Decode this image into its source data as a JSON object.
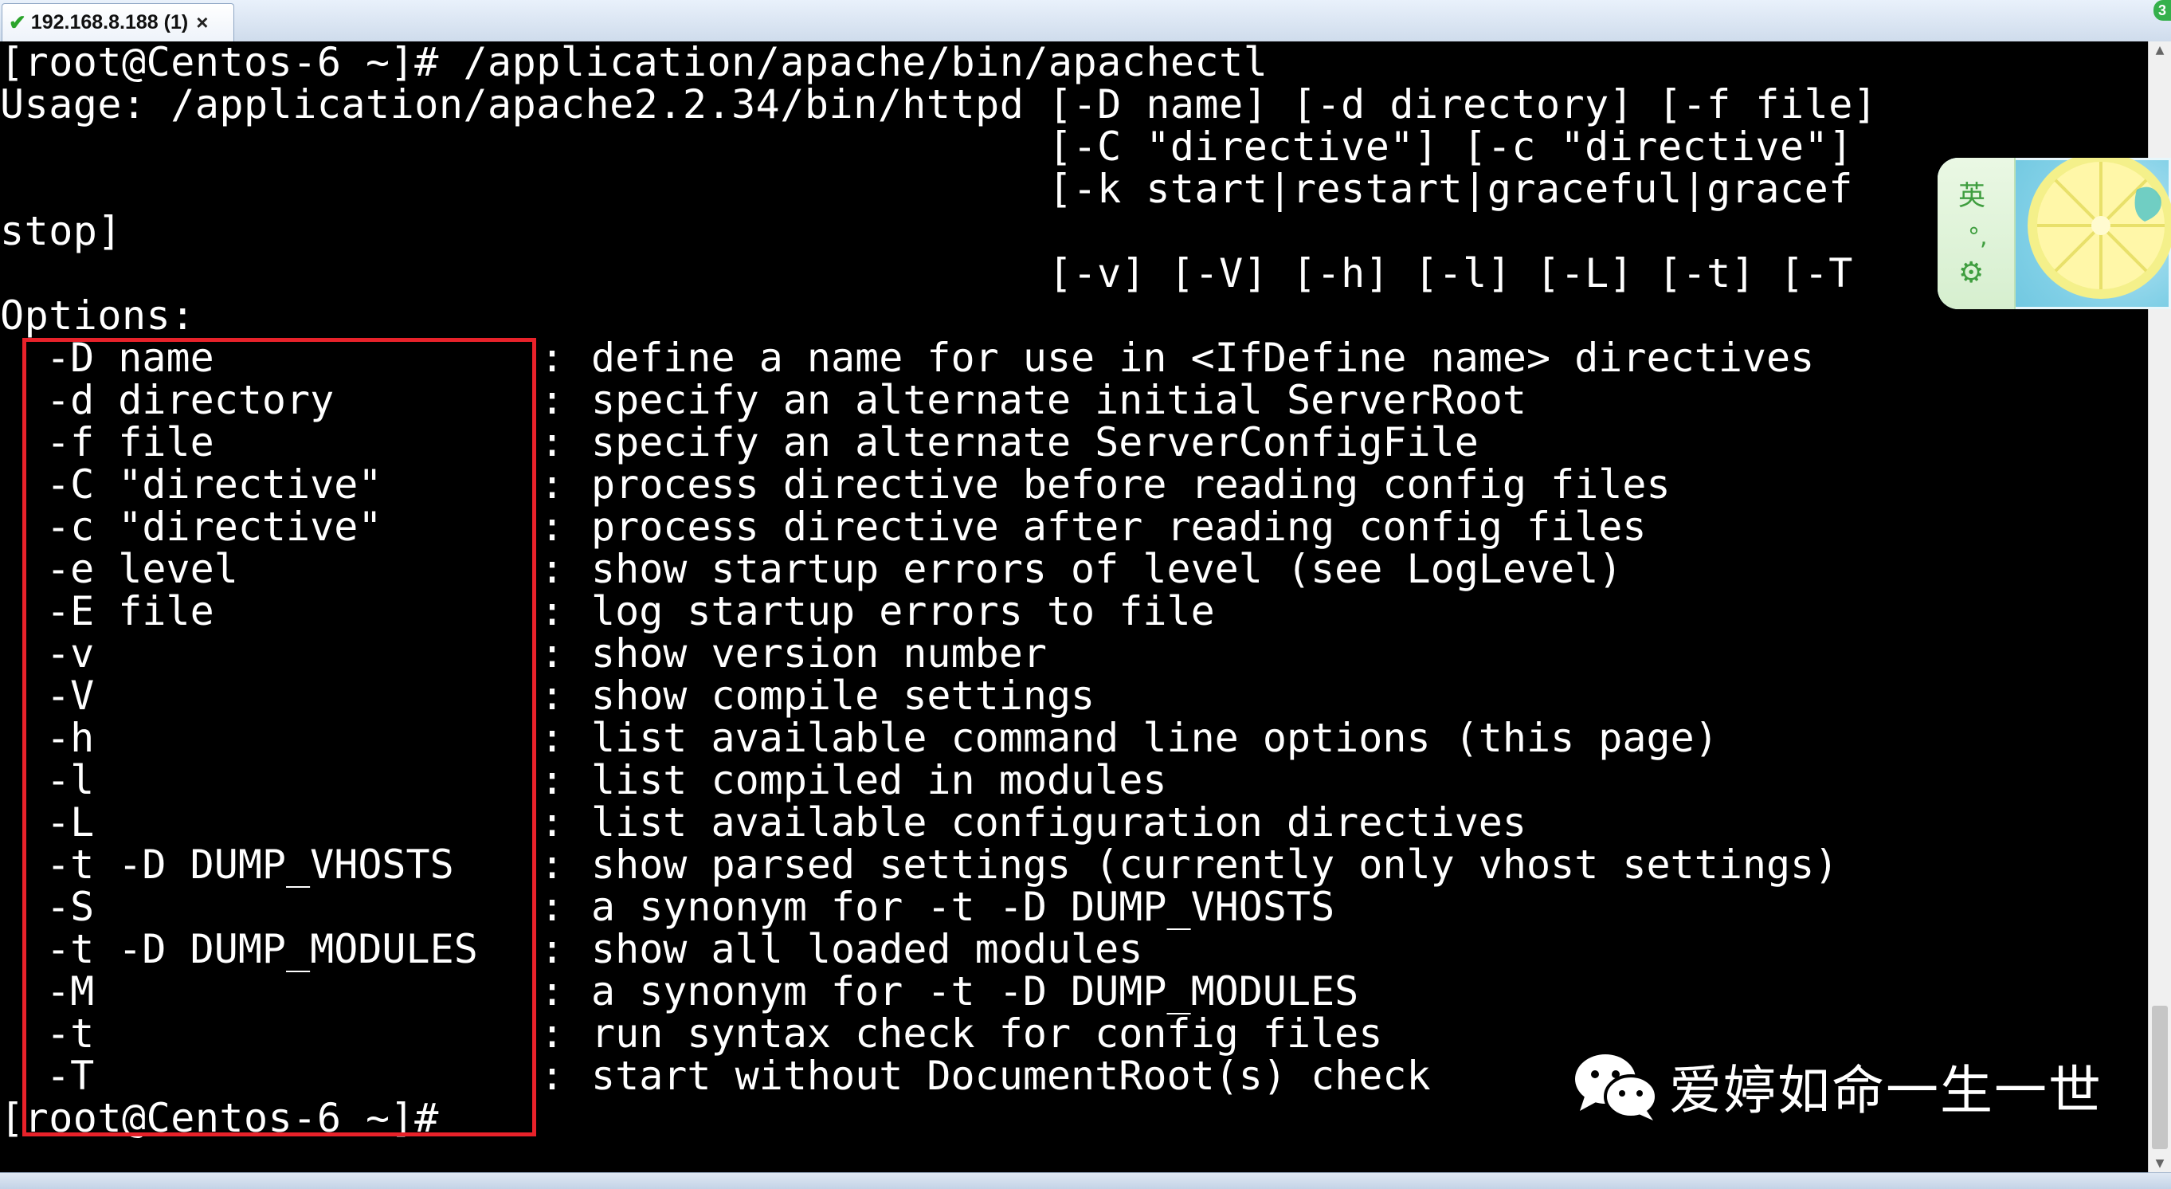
{
  "tab": {
    "title": "192.168.8.188 (1)",
    "close_glyph": "×",
    "status_icon": "check-icon"
  },
  "session_badge": "3",
  "terminal": {
    "lines": [
      "[root@Centos-6 ~]# /application/apache/bin/apachectl",
      "Usage: /application/apache2.2.34/bin/httpd [-D name] [-d directory] [-f file]",
      "                                           [-C \"directive\"] [-c \"directive\"]",
      "                                           [-k start|restart|graceful|gracef",
      "stop]",
      "                                           [-v] [-V] [-h] [-l] [-L] [-t] [-T",
      "Options:"
    ],
    "options": [
      {
        "flag": "-D name",
        "desc": "define a name for use in <IfDefine name> directives"
      },
      {
        "flag": "-d directory",
        "desc": "specify an alternate initial ServerRoot"
      },
      {
        "flag": "-f file",
        "desc": "specify an alternate ServerConfigFile"
      },
      {
        "flag": "-C \"directive\"",
        "desc": "process directive before reading config files"
      },
      {
        "flag": "-c \"directive\"",
        "desc": "process directive after reading config files"
      },
      {
        "flag": "-e level",
        "desc": "show startup errors of level (see LogLevel)"
      },
      {
        "flag": "-E file",
        "desc": "log startup errors to file"
      },
      {
        "flag": "-v",
        "desc": "show version number"
      },
      {
        "flag": "-V",
        "desc": "show compile settings"
      },
      {
        "flag": "-h",
        "desc": "list available command line options (this page)"
      },
      {
        "flag": "-l",
        "desc": "list compiled in modules"
      },
      {
        "flag": "-L",
        "desc": "list available configuration directives"
      },
      {
        "flag": "-t -D DUMP_VHOSTS",
        "desc": "show parsed settings (currently only vhost settings)"
      },
      {
        "flag": "-S",
        "desc": "a synonym for -t -D DUMP_VHOSTS"
      },
      {
        "flag": "-t -D DUMP_MODULES",
        "desc": "show all loaded modules"
      },
      {
        "flag": "-M",
        "desc": "a synonym for -t -D DUMP_MODULES"
      },
      {
        "flag": "-t",
        "desc": "run syntax check for config files"
      },
      {
        "flag": "-T",
        "desc": "start without DocumentRoot(s) check"
      }
    ],
    "option_separator": ":",
    "prompt": "[root@Centos-6 ~]#"
  },
  "ime": {
    "language": "英",
    "punctuation": "°,",
    "settings_icon": "gear-icon"
  },
  "watermark": {
    "icon": "wechat-icon",
    "text": "爱婷如命一生一世"
  },
  "colors": {
    "terminal_bg": "#000000",
    "terminal_fg": "#ffffff",
    "highlight_box": "#e8222a",
    "tab_check": "#2ba42b"
  }
}
